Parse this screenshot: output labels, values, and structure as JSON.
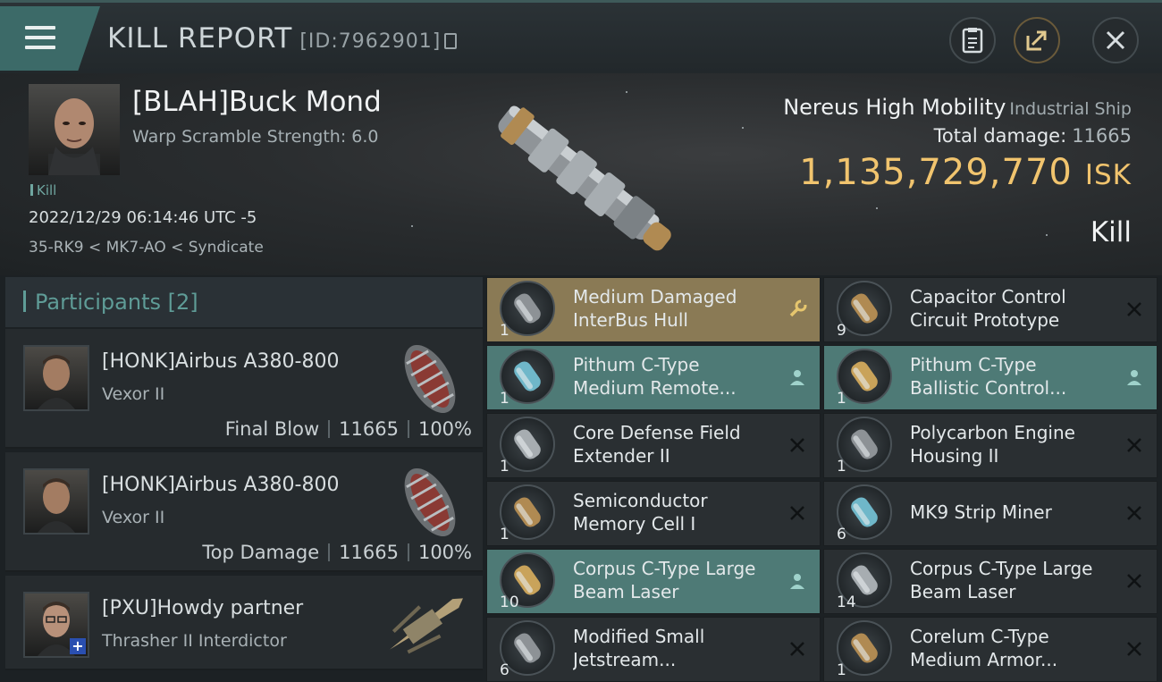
{
  "header": {
    "title": "KILL REPORT",
    "report_id": "[ID:7962901]",
    "icons": [
      "menu-icon",
      "copy-icon",
      "clipboard-icon",
      "share-icon",
      "close-icon"
    ]
  },
  "victim": {
    "name": "[BLAH]Buck Mond",
    "subtitle": "Warp Scramble Strength: 6.0",
    "tag": "Kill",
    "datetime": "2022/12/29 06:14:46 UTC -5",
    "location": "35-RK9 < MK7-AO < Syndicate",
    "ship_name": "Nereus High Mobility",
    "ship_class": "Industrial Ship",
    "total_damage_label": "Total damage:",
    "total_damage": "11665",
    "isk_value": "1,135,729,770",
    "isk_unit": "ISK",
    "result": "Kill"
  },
  "participants": {
    "label": "Participants",
    "count": "[2]",
    "cards": [
      {
        "name": "[HONK]Airbus A380-800",
        "ship": "Vexor II",
        "role": "Final Blow",
        "damage": "11665",
        "percent": "100%"
      },
      {
        "name": "[HONK]Airbus A380-800",
        "ship": "Vexor II",
        "role": "Top Damage",
        "damage": "11665",
        "percent": "100%"
      },
      {
        "name": "[PXU]Howdy partner",
        "ship": "Thrasher II Interdictor"
      }
    ]
  },
  "items": [
    {
      "qty": "1",
      "line1": "Medium Damaged",
      "line2": "InterBus Hull",
      "state": "damaged",
      "action": "wrench-icon"
    },
    {
      "qty": "9",
      "line1": "Capacitor Control",
      "line2": "Circuit Prototype",
      "state": "dropped",
      "action": "x-icon"
    },
    {
      "qty": "1",
      "line1": "Pithum C-Type",
      "line2": "Medium Remote...",
      "state": "fitted",
      "action": "person-icon"
    },
    {
      "qty": "1",
      "line1": "Pithum C-Type",
      "line2": "Ballistic Control...",
      "state": "fitted",
      "action": "person-icon"
    },
    {
      "qty": "1",
      "line1": "Core Defense Field",
      "line2": "Extender II",
      "state": "dropped",
      "action": "x-icon"
    },
    {
      "qty": "1",
      "line1": "Polycarbon Engine",
      "line2": "Housing II",
      "state": "dropped",
      "action": "x-icon"
    },
    {
      "qty": "1",
      "line1": "Semiconductor",
      "line2": "Memory Cell I",
      "state": "dropped",
      "action": "x-icon"
    },
    {
      "qty": "6",
      "line1": "MK9 Strip Miner",
      "line2": "",
      "state": "dropped",
      "action": "x-icon"
    },
    {
      "qty": "10",
      "line1": "Corpus C-Type Large",
      "line2": "Beam Laser",
      "state": "fitted",
      "action": "person-icon"
    },
    {
      "qty": "14",
      "line1": "Corpus C-Type Large",
      "line2": "Beam Laser",
      "state": "dropped",
      "action": "x-icon"
    },
    {
      "qty": "6",
      "line1": "Modified Small",
      "line2": "Jetstream...",
      "state": "dropped",
      "action": "x-icon"
    },
    {
      "qty": "1",
      "line1": "Corelum C-Type",
      "line2": "Medium Armor...",
      "state": "dropped",
      "action": "x-icon"
    }
  ],
  "colors": {
    "accent_teal": "#4e7a76",
    "isk_gold": "#f1c46e",
    "damaged_tan": "#8a7a55",
    "participants_label": "#5f9c97"
  }
}
